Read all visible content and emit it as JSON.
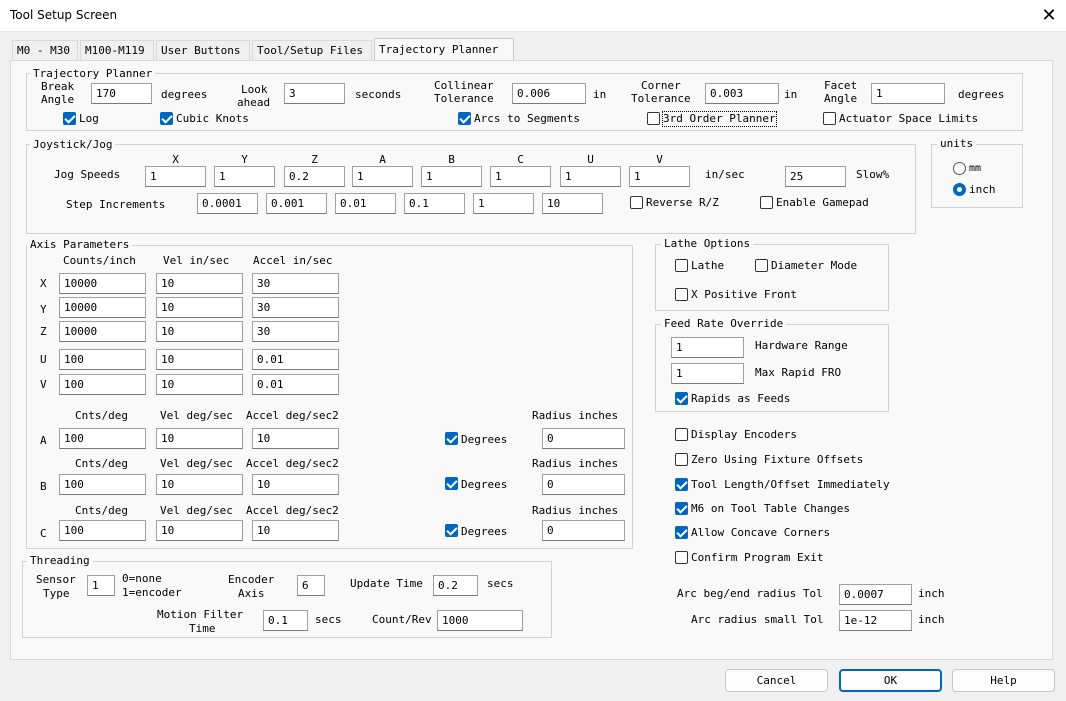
{
  "window": {
    "title": "Tool Setup Screen"
  },
  "tabs": [
    {
      "label": "M0 - M30"
    },
    {
      "label": "M100-M119"
    },
    {
      "label": "User Buttons"
    },
    {
      "label": "Tool/Setup Files"
    },
    {
      "label": "Trajectory Planner"
    }
  ],
  "trajectory": {
    "title": "Trajectory Planner",
    "break_angle_label_1": "Break",
    "break_angle_label_2": "Angle",
    "break_angle": "170",
    "break_angle_unit": "degrees",
    "look_ahead_label_1": "Look",
    "look_ahead_label_2": "ahead",
    "look_ahead": "3",
    "look_ahead_unit": "seconds",
    "collinear_label_1": "Collinear",
    "collinear_label_2": "Tolerance",
    "collinear": "0.006",
    "collinear_unit": "in",
    "corner_label_1": "Corner",
    "corner_label_2": "Tolerance",
    "corner": "0.003",
    "corner_unit": "in",
    "facet_label_1": "Facet",
    "facet_label_2": "Angle",
    "facet": "1",
    "facet_unit": "degrees",
    "log_label": "Log",
    "cubic_label": "Cubic Knots",
    "arcs_label": "Arcs to Segments",
    "third_order_label": "3rd Order Planner",
    "actuator_label": "Actuator Space Limits"
  },
  "jog": {
    "title": "Joystick/Jog",
    "axes": [
      "X",
      "Y",
      "Z",
      "A",
      "B",
      "C",
      "U",
      "V"
    ],
    "speeds_label": "Jog Speeds",
    "speeds": [
      "1",
      "1",
      "0.2",
      "1",
      "1",
      "1",
      "1",
      "1"
    ],
    "speeds_unit": "in/sec",
    "slow": "25",
    "slow_label": "Slow%",
    "step_label": "Step Increments",
    "steps": [
      "0.0001",
      "0.001",
      "0.01",
      "0.1",
      "1",
      "10"
    ],
    "reverse_label": "Reverse R/Z",
    "gamepad_label": "Enable Gamepad"
  },
  "units": {
    "title": "units",
    "mm_label": "mm",
    "inch_label": "inch"
  },
  "axis": {
    "title": "Axis Parameters",
    "hdr_counts": "Counts/inch",
    "hdr_vel": "Vel in/sec",
    "hdr_accel": "Accel in/sec",
    "linear": [
      {
        "name": "X",
        "counts": "10000",
        "vel": "10",
        "accel": "30"
      },
      {
        "name": "Y",
        "counts": "10000",
        "vel": "10",
        "accel": "30"
      },
      {
        "name": "Z",
        "counts": "10000",
        "vel": "10",
        "accel": "30"
      },
      {
        "name": "U",
        "counts": "100",
        "vel": "10",
        "accel": "0.01"
      },
      {
        "name": "V",
        "counts": "100",
        "vel": "10",
        "accel": "0.01"
      }
    ],
    "rot_hdr_counts": "Cnts/deg",
    "rot_hdr_vel": "Vel deg/sec",
    "rot_hdr_accel": "Accel deg/sec2",
    "rot_hdr_radius": "Radius inches",
    "degrees_label": "Degrees",
    "rotary": [
      {
        "name": "A",
        "counts": "100",
        "vel": "10",
        "accel": "10",
        "radius": "0"
      },
      {
        "name": "B",
        "counts": "100",
        "vel": "10",
        "accel": "10",
        "radius": "0"
      },
      {
        "name": "C",
        "counts": "100",
        "vel": "10",
        "accel": "10",
        "radius": "0"
      }
    ]
  },
  "lathe": {
    "title": "Lathe Options",
    "lathe_label": "Lathe",
    "diameter_label": "Diameter Mode",
    "xpos_label": "X Positive Front"
  },
  "fro": {
    "title": "Feed Rate Override",
    "hw_range": "1",
    "hw_range_label": "Hardware Range",
    "max_rapid": "1",
    "max_rapid_label": "Max Rapid FRO",
    "rapids_label": "Rapids as Feeds"
  },
  "options": {
    "display_encoders": "Display Encoders",
    "zero_fixture": "Zero Using Fixture Offsets",
    "tool_length": "Tool Length/Offset Immediately",
    "m6": "M6 on Tool Table Changes",
    "concave": "Allow Concave Corners",
    "confirm_exit": "Confirm Program Exit",
    "arc_beg_label": "Arc beg/end radius Tol",
    "arc_beg": "0.0007",
    "arc_beg_unit": "inch",
    "arc_small_label": "Arc radius small Tol",
    "arc_small": "1e-12",
    "arc_small_unit": "inch"
  },
  "threading": {
    "title": "Threading",
    "sensor_label_1": "Sensor",
    "sensor_label_2": "Type",
    "sensor": "1",
    "sensor_note_1": "0=none",
    "sensor_note_2": "1=encoder",
    "enc_axis_label_1": "Encoder",
    "enc_axis_label_2": "Axis",
    "enc_axis": "6",
    "update_label": "Update Time",
    "update": "0.2",
    "update_unit": "secs",
    "motion_label_1": "Motion Filter",
    "motion_label_2": "Time",
    "motion": "0.1",
    "motion_unit": "secs",
    "count_label": "Count/Rev",
    "count": "1000"
  },
  "buttons": {
    "cancel": "Cancel",
    "ok": "OK",
    "help": "Help"
  }
}
